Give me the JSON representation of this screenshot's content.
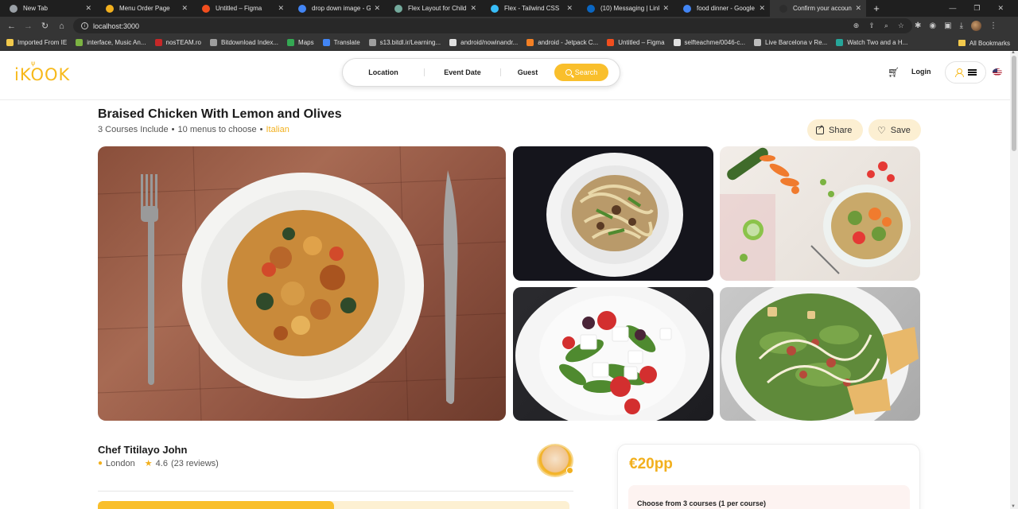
{
  "browser": {
    "tabs": [
      {
        "label": "New Tab",
        "color": "#9aa0a6",
        "active": false
      },
      {
        "label": "Menu Order Page",
        "color": "#f2b01e",
        "active": false
      },
      {
        "label": "Untitled – Figma",
        "color": "#f24e1e",
        "active": false
      },
      {
        "label": "drop down image - G",
        "color": "#4285f4",
        "active": false
      },
      {
        "label": "Flex Layout for Child",
        "color": "#74aa9c",
        "active": false
      },
      {
        "label": "Flex - Tailwind CSS",
        "color": "#38bdf8",
        "active": false
      },
      {
        "label": "(10) Messaging | Link",
        "color": "#0a66c2",
        "active": false
      },
      {
        "label": "food dinner - Google",
        "color": "#4285f4",
        "active": false
      },
      {
        "label": "Confirm your accoun",
        "color": "#2d2d2d",
        "active": true
      }
    ],
    "new_tab": "+",
    "url": "localhost:3000",
    "bookmarks": [
      {
        "label": "Imported From IE",
        "color": "#f2c94c"
      },
      {
        "label": "interface, Music An...",
        "color": "#7cb342"
      },
      {
        "label": "nosTEAM.ro",
        "color": "#c62828"
      },
      {
        "label": "Bitdownload Index...",
        "color": "#9e9e9e"
      },
      {
        "label": "Maps",
        "color": "#34a853"
      },
      {
        "label": "Translate",
        "color": "#4285f4"
      },
      {
        "label": "s13.bitdl.ir/Learning...",
        "color": "#9e9e9e"
      },
      {
        "label": "android/nowinandr...",
        "color": "#e0e0e0"
      },
      {
        "label": "android - Jetpack C...",
        "color": "#f48024"
      },
      {
        "label": "Untitled – Figma",
        "color": "#f24e1e"
      },
      {
        "label": "selfteachme/0046-c...",
        "color": "#e0e0e0"
      },
      {
        "label": "Live Barcelona v Re...",
        "color": "#bdbdbd"
      },
      {
        "label": "Watch Two and a H...",
        "color": "#26a69a"
      }
    ],
    "all_bookmarks": "All Bookmarks"
  },
  "header": {
    "logo": "iKOOK",
    "search": {
      "location": "Location",
      "event_date": "Event Date",
      "guest": "Guest",
      "button": "Search"
    },
    "login": "Login"
  },
  "listing": {
    "title": "Braised Chicken With Lemon and Olives",
    "courses": "3 Courses Include",
    "menus": "10 menus to choose",
    "cuisine": "Italian",
    "share": "Share",
    "save": "Save"
  },
  "chef": {
    "name": "Chef Titilayo John",
    "location": "London",
    "rating": "4.6",
    "reviews": "(23 reviews)"
  },
  "booking": {
    "price": "€20pp",
    "course_hint": "Choose from 3 courses (1 per course)",
    "progress_fraction": 0.5
  },
  "colors": {
    "brand": "#f7b91b",
    "button": "#f9bf2c",
    "chip_bg": "#fcefd2"
  }
}
